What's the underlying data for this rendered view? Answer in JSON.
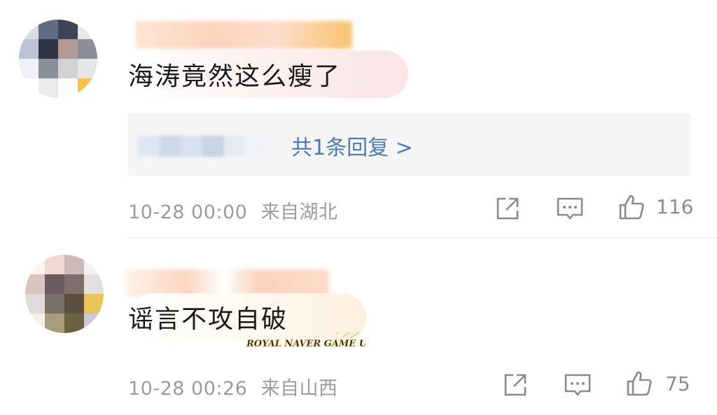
{
  "comments": [
    {
      "text": "海涛竟然这么瘦了",
      "reply_link": "共1条回复 >",
      "timestamp": "10-28 00:00",
      "location": "来自湖北",
      "likes": "116",
      "actions": [
        "share-icon",
        "comment-icon",
        "like-icon"
      ]
    },
    {
      "text": "谣言不攻自破",
      "timestamp": "10-28 00:26",
      "location": "来自山西",
      "likes": "75",
      "actions": [
        "share-icon",
        "comment-icon",
        "like-icon"
      ]
    }
  ],
  "watermark": {
    "text": "ROYAL NAVER GAME UP"
  },
  "colors": {
    "reply_link": "#4d7db3",
    "meta_text": "#9c9c9c",
    "reply_box": "#f5f5f6",
    "bubble1": "#fbeaea",
    "bubble2": "#fdf6ec"
  }
}
